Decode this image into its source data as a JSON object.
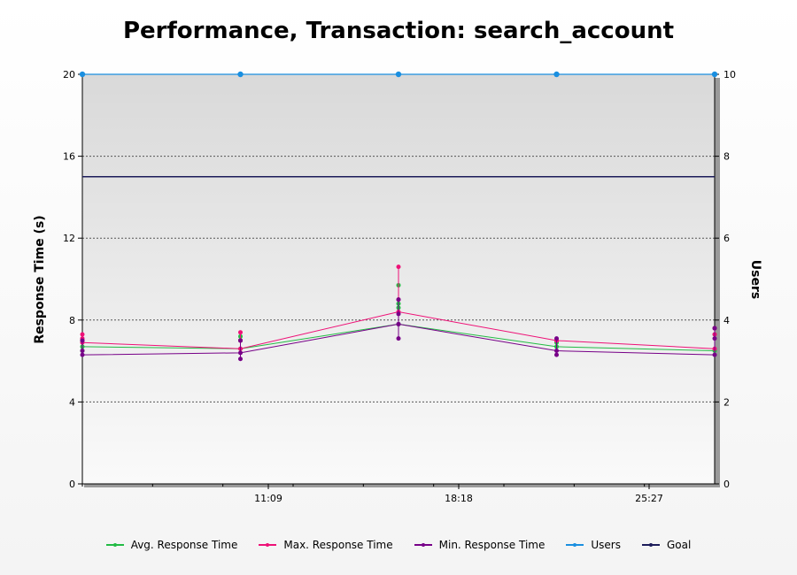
{
  "chart_data": {
    "type": "line",
    "title": "Performance, Transaction: search_account",
    "ylabel": "Response Time (s)",
    "y2label": "Users",
    "ylim": [
      0,
      20
    ],
    "y2lim": [
      0,
      10
    ],
    "yticks": [
      0,
      4,
      8,
      12,
      16,
      20
    ],
    "y2ticks": [
      0,
      2,
      4,
      6,
      8,
      10
    ],
    "xticks": [
      "11:09",
      "18:18",
      "25:27"
    ],
    "grid": true,
    "legend_position": "bottom",
    "colors": {
      "avg": "#22bb44",
      "max": "#ee1177",
      "min": "#770088",
      "users": "#1a8fe0",
      "goal": "#1c1c5a"
    },
    "series": [
      {
        "name": "Avg. Response Time",
        "points": [
          [
            0,
            6.7
          ],
          [
            6,
            6.6
          ],
          [
            12,
            7.8
          ],
          [
            18,
            6.7
          ],
          [
            24,
            6.5
          ]
        ],
        "extra_points": [
          [
            0,
            7.0
          ],
          [
            0,
            6.5
          ],
          [
            6,
            7.2
          ],
          [
            6,
            7.0
          ],
          [
            12,
            9.7
          ],
          [
            12,
            8.6
          ],
          [
            12,
            8.8
          ],
          [
            18,
            6.9
          ],
          [
            24,
            7.6
          ],
          [
            24,
            7.3
          ]
        ]
      },
      {
        "name": "Max. Response Time",
        "points": [
          [
            0,
            6.9
          ],
          [
            6,
            6.6
          ],
          [
            12,
            8.4
          ],
          [
            18,
            7.0
          ],
          [
            24,
            6.6
          ]
        ],
        "extra_points": [
          [
            0,
            7.3
          ],
          [
            0,
            7.1
          ],
          [
            6,
            7.4
          ],
          [
            6,
            7.0
          ],
          [
            12,
            10.6
          ],
          [
            12,
            9.0
          ],
          [
            18,
            7.0
          ],
          [
            24,
            7.6
          ],
          [
            24,
            7.3
          ]
        ]
      },
      {
        "name": "Min. Response Time",
        "points": [
          [
            0,
            6.3
          ],
          [
            6,
            6.4
          ],
          [
            12,
            7.8
          ],
          [
            18,
            6.5
          ],
          [
            24,
            6.3
          ]
        ],
        "extra_points": [
          [
            0,
            6.5
          ],
          [
            0,
            7.0
          ],
          [
            6,
            6.1
          ],
          [
            6,
            7.0
          ],
          [
            12,
            7.1
          ],
          [
            12,
            8.3
          ],
          [
            12,
            9.0
          ],
          [
            18,
            6.3
          ],
          [
            18,
            7.1
          ],
          [
            24,
            7.6
          ],
          [
            24,
            7.1
          ]
        ]
      },
      {
        "name": "Users",
        "axis": "right",
        "points": [
          [
            0,
            10
          ],
          [
            6,
            10
          ],
          [
            12,
            10
          ],
          [
            18,
            10
          ],
          [
            24,
            10
          ]
        ]
      },
      {
        "name": "Goal",
        "points": [
          [
            0,
            15
          ],
          [
            24,
            15
          ]
        ]
      }
    ]
  }
}
